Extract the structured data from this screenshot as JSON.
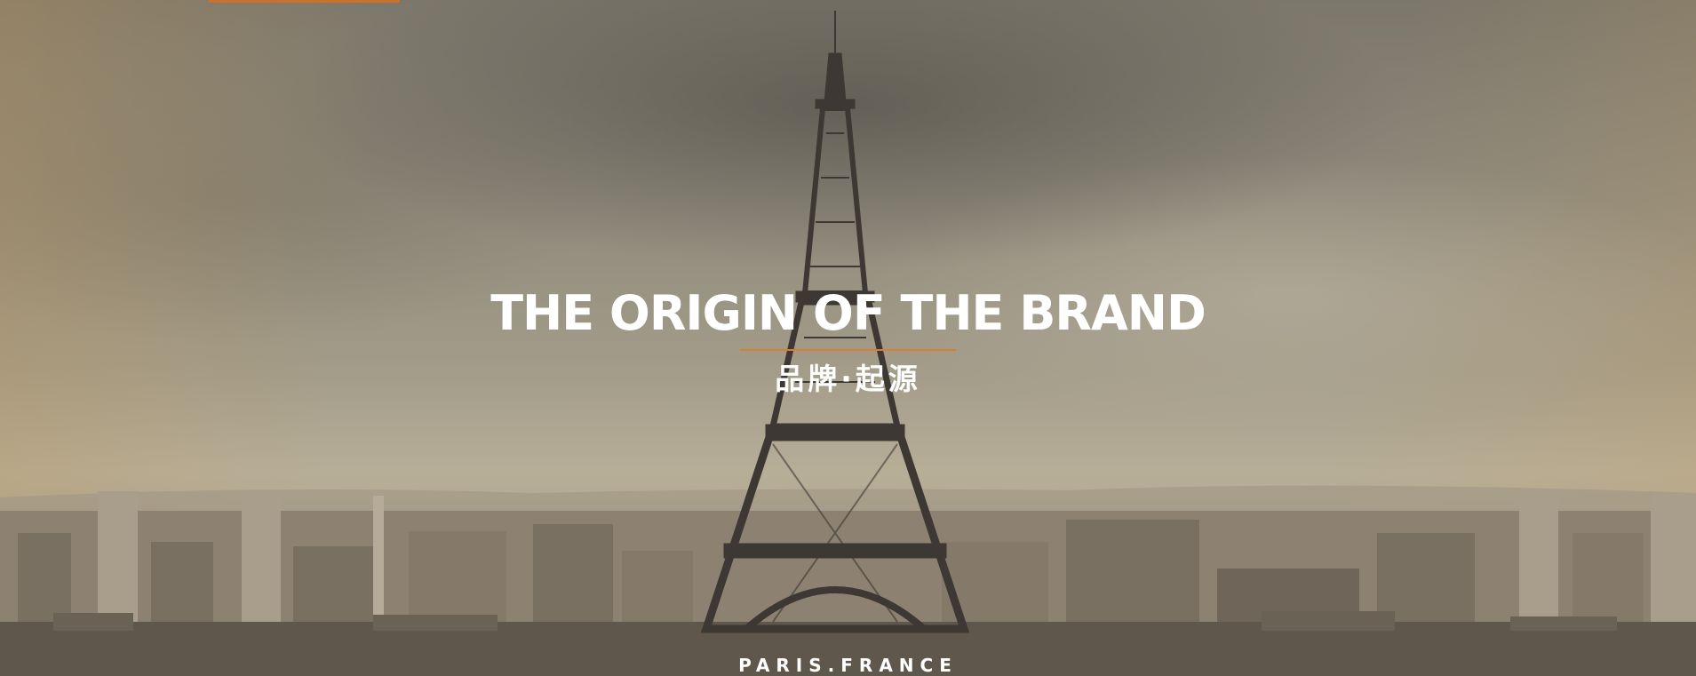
{
  "hero": {
    "title": "THE ORIGIN OF THE BRAND",
    "subtitle": "品牌·起源",
    "location": "PARIS.FRANCE",
    "background_image": "eiffel-tower-paris-skyline",
    "accent_color": "#d97e2f",
    "text_color": "#ffffff"
  }
}
